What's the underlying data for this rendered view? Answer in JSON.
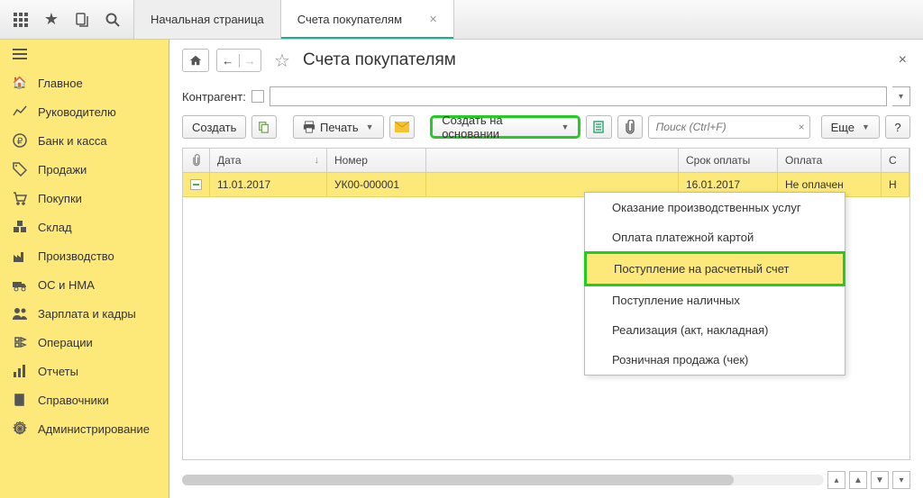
{
  "topbar": {
    "tabs": [
      {
        "label": "Начальная страница",
        "active": false
      },
      {
        "label": "Счета покупателям",
        "active": true
      }
    ]
  },
  "sidebar": {
    "items": [
      {
        "label": "Главное",
        "icon": "home"
      },
      {
        "label": "Руководителю",
        "icon": "chart"
      },
      {
        "label": "Банк и касса",
        "icon": "ruble"
      },
      {
        "label": "Продажи",
        "icon": "tag"
      },
      {
        "label": "Покупки",
        "icon": "cart"
      },
      {
        "label": "Склад",
        "icon": "boxes"
      },
      {
        "label": "Производство",
        "icon": "factory"
      },
      {
        "label": "ОС и НМА",
        "icon": "truck"
      },
      {
        "label": "Зарплата и кадры",
        "icon": "people"
      },
      {
        "label": "Операции",
        "icon": "ops"
      },
      {
        "label": "Отчеты",
        "icon": "bars"
      },
      {
        "label": "Справочники",
        "icon": "book"
      },
      {
        "label": "Администрирование",
        "icon": "gear"
      }
    ]
  },
  "header": {
    "title": "Счета покупателям",
    "filter_label": "Контрагент:"
  },
  "toolbar": {
    "create": "Создать",
    "print": "Печать",
    "create_based_on": "Создать на основании",
    "search_placeholder": "Поиск (Ctrl+F)",
    "more": "Еще"
  },
  "table": {
    "columns": {
      "date": "Дата",
      "number": "Номер",
      "due": "Срок оплаты",
      "payment": "Оплата",
      "last": "С"
    },
    "rows": [
      {
        "date": "11.01.2017",
        "number": "УК00-000001",
        "due": "16.01.2017",
        "payment": "Не оплачен",
        "last": "Н"
      }
    ]
  },
  "dropdown": {
    "items": [
      "Оказание производственных услуг",
      "Оплата платежной картой",
      "Поступление на расчетный счет",
      "Поступление наличных",
      "Реализация (акт, накладная)",
      "Розничная продажа (чек)"
    ],
    "highlighted_index": 2
  }
}
